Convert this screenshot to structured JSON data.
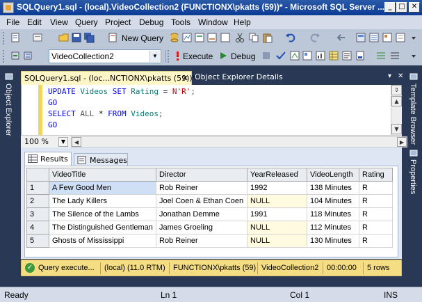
{
  "window": {
    "title": "SQLQuery1.sql - (local).VideoCollection2 (FUNCTIONX\\pkatts (59))* - Microsoft SQL Server ...",
    "minimize": "_",
    "maximize": "□",
    "close": "✕"
  },
  "menu": [
    "File",
    "Edit",
    "View",
    "Query",
    "Project",
    "Debug",
    "Tools",
    "Window",
    "Help"
  ],
  "toolbar1": {
    "new_query": "New Query"
  },
  "toolbar2": {
    "database": "VideoCollection2",
    "execute": "Execute",
    "debug": "Debug"
  },
  "side": {
    "left_tab": "Object Explorer",
    "right_tab1": "Template Browser",
    "right_tab2": "Properties"
  },
  "doc_tabs": {
    "active": "SQLQuery1.sql - (loc...NCTIONX\\pkatts (59))*",
    "active_close": "✕",
    "inactive": "Object Explorer Details"
  },
  "editor": {
    "lines": [
      [
        {
          "t": "UPDATE",
          "c": "kw"
        },
        {
          "t": " "
        },
        {
          "t": "Videos",
          "c": "idn"
        },
        {
          "t": " "
        },
        {
          "t": "SET",
          "c": "kw"
        },
        {
          "t": " "
        },
        {
          "t": "Rating",
          "c": "idn"
        },
        {
          "t": " = "
        },
        {
          "t": "N'R'",
          "c": "str"
        },
        {
          "t": ";",
          "c": "pun"
        }
      ],
      [
        {
          "t": "GO",
          "c": "kw"
        }
      ],
      [
        {
          "t": "SELECT",
          "c": "kw"
        },
        {
          "t": " "
        },
        {
          "t": "ALL",
          "c": "pun"
        },
        {
          "t": " * "
        },
        {
          "t": "FROM",
          "c": "kw"
        },
        {
          "t": " "
        },
        {
          "t": "Videos",
          "c": "idn"
        },
        {
          "t": ";",
          "c": "pun"
        }
      ],
      [
        {
          "t": "GO",
          "c": "kw"
        }
      ]
    ]
  },
  "zoom": "100 %",
  "results_tabs": {
    "results": "Results",
    "messages": "Messages"
  },
  "grid": {
    "columns": [
      "VideoTitle",
      "Director",
      "YearReleased",
      "VideoLength",
      "Rating"
    ],
    "rows": [
      [
        "1",
        "A Few Good Men",
        "Rob Reiner",
        "1992",
        "138 Minutes",
        "R"
      ],
      [
        "2",
        "The Lady Killers",
        "Joel Coen & Ethan Coen",
        "NULL",
        "104 Minutes",
        "R"
      ],
      [
        "3",
        "The Silence of the Lambs",
        "Jonathan Demme",
        "1991",
        "118 Minutes",
        "R"
      ],
      [
        "4",
        "The Distinguished Gentleman",
        "James Groeling",
        "NULL",
        "112 Minutes",
        "R"
      ],
      [
        "5",
        "Ghosts of Mississippi",
        "Rob Reiner",
        "NULL",
        "130 Minutes",
        "R"
      ]
    ]
  },
  "query_status": {
    "message": "Query execute...",
    "server": "(local) (11.0 RTM)",
    "user": "FUNCTIONX\\pkatts (59)",
    "database": "VideoCollection2",
    "time": "00:00:00",
    "rows": "5 rows"
  },
  "statusbar": {
    "ready": "Ready",
    "ln": "Ln 1",
    "col": "Col 1",
    "ins": "INS"
  }
}
